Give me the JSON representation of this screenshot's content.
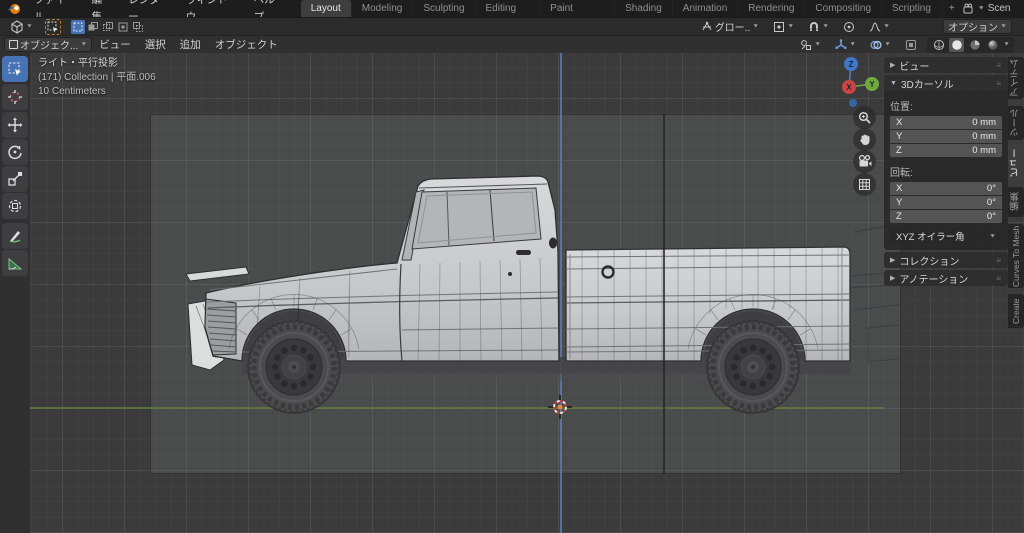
{
  "topbar": {
    "menus": [
      "ファイル",
      "編集",
      "レンダー",
      "ウィンドウ",
      "ヘルプ"
    ],
    "tabs": [
      "Layout",
      "Modeling",
      "Sculpting",
      "UV Editing",
      "Texture Paint",
      "Shading",
      "Animation",
      "Rendering",
      "Compositing",
      "Scripting"
    ],
    "active_tab": "Layout",
    "add_tab": "+",
    "scene_label": "Scen"
  },
  "header2": {
    "orientation_label": "グロー..",
    "options_label": "オプション"
  },
  "header3": {
    "mode_label": "オブジェク...",
    "menus": [
      "ビュー",
      "選択",
      "追加",
      "オブジェクト"
    ]
  },
  "viewport": {
    "overlay_line1": "ライト・平行投影",
    "overlay_line2": "(171) Collection | 平面.006",
    "overlay_line3": "10 Centimeters",
    "gizmo": {
      "x": "X",
      "y": "Y",
      "z": "Z"
    }
  },
  "npanel": {
    "view_label": "ビュー",
    "cursor_label": "3Dカーソル",
    "location_label": "位置:",
    "loc": [
      {
        "axis": "X",
        "value": "0 mm"
      },
      {
        "axis": "Y",
        "value": "0 mm"
      },
      {
        "axis": "Z",
        "value": "0 mm"
      }
    ],
    "rotation_label": "回転:",
    "rot": [
      {
        "axis": "X",
        "value": "0°"
      },
      {
        "axis": "Y",
        "value": "0°"
      },
      {
        "axis": "Z",
        "value": "0°"
      }
    ],
    "euler_label": "XYZ オイラー角",
    "collection_label": "コレクション",
    "annotation_label": "アノテーション",
    "tabs": [
      "アイテム",
      "ツール",
      "ビュー",
      "編集",
      "Curves To Mesh",
      "Create"
    ],
    "active_tab": "ビュー"
  },
  "colors": {
    "accent": "#4772b3",
    "axis_z": "#5c7ab0",
    "axis_y": "#62783e",
    "cursor_orange": "#e8883a"
  }
}
